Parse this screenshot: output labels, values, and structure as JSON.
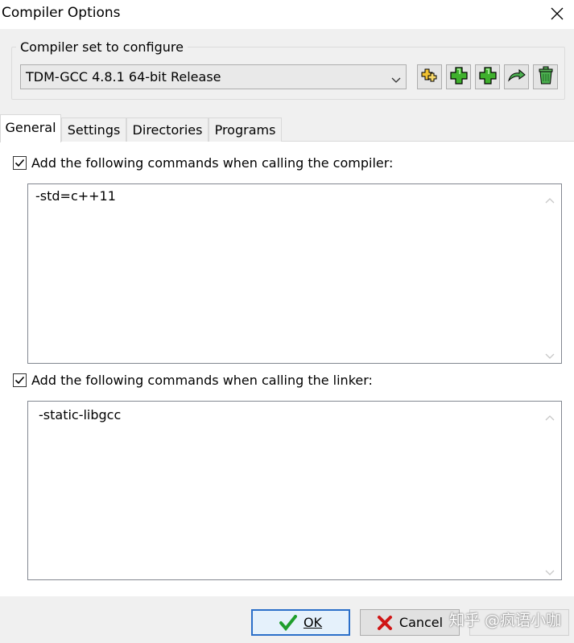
{
  "window": {
    "title": "Compiler Options"
  },
  "compiler_set": {
    "group_label": "Compiler set to configure",
    "selected": "TDM-GCC 4.8.1 64-bit Release",
    "tools": [
      {
        "name": "find-compilers"
      },
      {
        "name": "add-compiler"
      },
      {
        "name": "add-compiler-folder"
      },
      {
        "name": "rename-compiler"
      },
      {
        "name": "delete-compiler"
      }
    ]
  },
  "tabs": [
    {
      "label": "General",
      "active": true
    },
    {
      "label": "Settings",
      "active": false
    },
    {
      "label": "Directories",
      "active": false
    },
    {
      "label": "Programs",
      "active": false
    }
  ],
  "general": {
    "compiler_cmd": {
      "checked": true,
      "label": "Add the following commands when calling the compiler:",
      "value": "-std=c++11"
    },
    "linker_cmd": {
      "checked": true,
      "label": "Add the following commands when calling the linker:",
      "value": "-static-libgcc"
    }
  },
  "buttons": {
    "ok": "OK",
    "cancel": "Cancel"
  },
  "watermark": "知乎 @疯语小咖"
}
